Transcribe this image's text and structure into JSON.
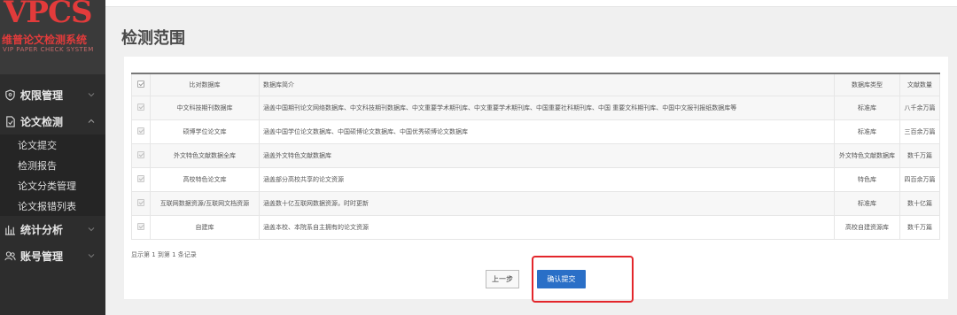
{
  "sidebar": {
    "logo": {
      "main": "VPCS",
      "cn": "维普论文检测系统",
      "en": "VIP PAPER CHECK SYSTEM"
    },
    "menu": [
      {
        "label": "权限管理",
        "icon": "shield-icon",
        "expanded": false
      },
      {
        "label": "论文检测",
        "icon": "document-check-icon",
        "expanded": true,
        "children": [
          "论文提交",
          "检测报告",
          "论文分类管理",
          "论文报错列表"
        ]
      },
      {
        "label": "统计分析",
        "icon": "bar-chart-icon",
        "expanded": false
      },
      {
        "label": "账号管理",
        "icon": "users-icon",
        "expanded": false
      }
    ]
  },
  "page": {
    "title": "检测范围"
  },
  "table": {
    "columns": [
      "比对数据库",
      "数据库简介",
      "数据库类型",
      "文献数量"
    ],
    "rows": [
      {
        "name": "中文科技期刊数据库",
        "desc": "涵盖中国期刊论文网络数据库、中文科技期刊数据库、中文重要学术期刊库、中文重要学术期刊库、中国重要社科期刊库、中国 重要文科期刊库、中国中文报刊报纸数据库等",
        "type": "标准库",
        "count": "八千余万篇"
      },
      {
        "name": "硕博学位论文库",
        "desc": "涵盖中国学位论文数据库、中国硕博论文数据库、中国优秀硕博论文数据库",
        "type": "标准库",
        "count": "三百余万篇"
      },
      {
        "name": "外文特色文献数据全库",
        "desc": "涵盖外文特色文献数据库",
        "type": "外文特色文献数据库",
        "count": "数千万篇"
      },
      {
        "name": "高校特色论文库",
        "desc": "涵盖部分高校共享的论文资源",
        "type": "特色库",
        "count": "四百余万篇"
      },
      {
        "name": "互联网数据资源/互联网文档资源",
        "desc": "涵盖数十亿互联网数据资源，时时更新",
        "type": "标准库",
        "count": "数十亿篇"
      },
      {
        "name": "自建库",
        "desc": "涵盖本校、本院系自主拥有的论文资源",
        "type": "高校自建资源库",
        "count": "数千万篇"
      }
    ]
  },
  "footer": {
    "records": "显示第 1 到第 1 条记录",
    "prev_label": "上一步",
    "submit_label": "确认提交"
  },
  "colors": {
    "accent": "#2a6fc7",
    "highlight": "#e3262b",
    "logo": "#e23b3b",
    "sidebar": "#2d2d2d"
  }
}
